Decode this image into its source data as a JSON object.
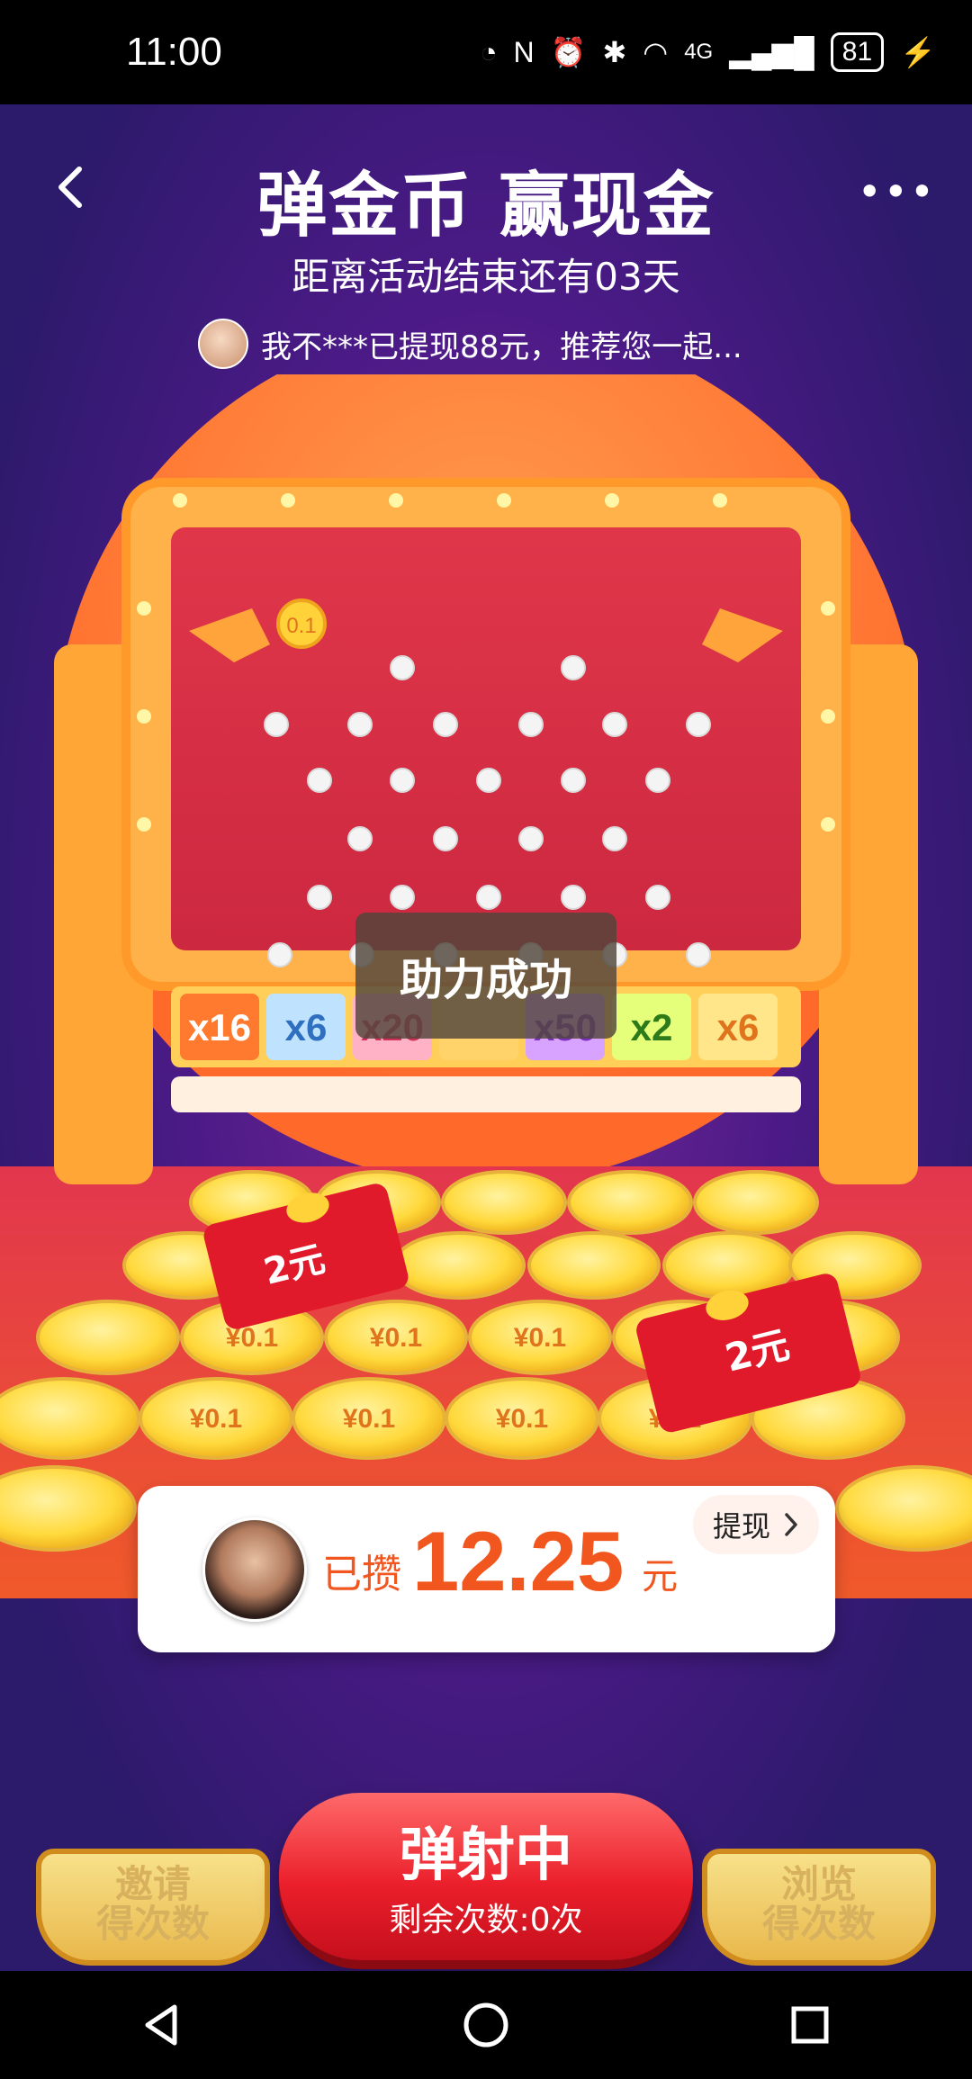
{
  "status_bar": {
    "time": "11:00",
    "network": "4G",
    "battery": "81"
  },
  "header": {
    "title": "弹金币 赢现金",
    "countdown": "距离活动结束还有03天",
    "ticker_text": "我不***已提现88元，推荐您一起..."
  },
  "board": {
    "bubble_value": "0.1",
    "multipliers": [
      "x16",
      "x6",
      "x20",
      "",
      "x50",
      "x2",
      "x6"
    ],
    "coin_value": "¥0.1",
    "redpacket_value": "2元"
  },
  "toast": {
    "text": "助力成功"
  },
  "balance": {
    "label": "已攒",
    "amount": "12.25",
    "unit": "元",
    "withdraw_label": "提现"
  },
  "actions": {
    "invite": {
      "line1": "邀请",
      "line2": "得次数"
    },
    "main": {
      "line1": "弹射中",
      "line2": "剩余次数:0次"
    },
    "browse": {
      "line1": "浏览",
      "line2": "得次数"
    }
  },
  "colors": {
    "accent": "#f0561d",
    "board_red": "#e0364a",
    "frame_orange": "#ffb24a",
    "coin_yellow": "#ffe25a"
  }
}
